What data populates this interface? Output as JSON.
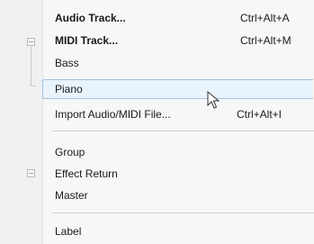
{
  "menu": {
    "items": [
      {
        "label": "Audio Track...",
        "shortcut": "Ctrl+Alt+A"
      },
      {
        "label": "MIDI Track...",
        "shortcut": "Ctrl+Alt+M"
      },
      {
        "label": "Bass",
        "shortcut": ""
      },
      {
        "label": "Piano",
        "shortcut": ""
      },
      {
        "label": "Import Audio/MIDI File...",
        "shortcut": "Ctrl+Alt+I"
      },
      {
        "label": "Group",
        "shortcut": ""
      },
      {
        "label": "Effect Return",
        "shortcut": ""
      },
      {
        "label": "Master",
        "shortcut": ""
      },
      {
        "label": "Label",
        "shortcut": ""
      }
    ]
  },
  "colors": {
    "highlight_bg": "#e9f3fb",
    "highlight_border": "#9fc3e3"
  }
}
